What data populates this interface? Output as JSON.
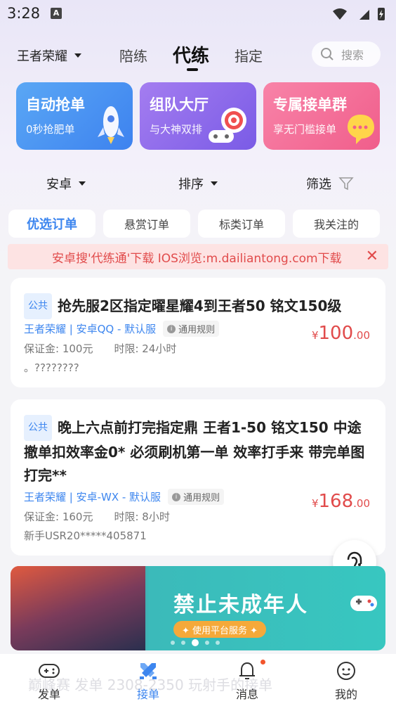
{
  "status_bar": {
    "time": "3:28",
    "notif_letter": "A"
  },
  "top_nav": {
    "game": "王者荣耀",
    "tabs": [
      "陪练",
      "代练",
      "指定"
    ],
    "active_tab": "代练",
    "search_placeholder": "搜索"
  },
  "features": [
    {
      "title": "自动抢单",
      "subtitle": "0秒抢肥单"
    },
    {
      "title": "组队大厅",
      "subtitle": "与大神双排"
    },
    {
      "title": "专属接单群",
      "subtitle": "享无门槛接单"
    }
  ],
  "filters": {
    "platform": "安卓",
    "sort": "排序",
    "filter": "筛选"
  },
  "order_tabs": [
    "优选订单",
    "悬赏订单",
    "标类订单",
    "我关注的"
  ],
  "notice": "安卓搜'代练通'下载 IOS浏览:m.dailiantong.com下载",
  "orders": [
    {
      "badge": "公共",
      "title": "抢先服2区指定曜星耀4到王者50 铭文150级",
      "meta": "王者荣耀 | 安卓QQ - 默认服",
      "rule": "通用规则",
      "deposit": "保证金: 100元",
      "time_limit": "时限: 24小时",
      "note": "。????????",
      "price_symbol": "¥",
      "price_int": "100",
      "price_dec": ".00"
    },
    {
      "badge": "公共",
      "title": "晚上六点前打完指定鼎 王者1-50 铭文150 中途撤单扣效率金0* 必须刷机第一单 效率打手来 带完单图 打完**",
      "meta": "王者荣耀 | 安卓-WX - 默认服",
      "rule": "通用规则",
      "deposit": "保证金: 160元",
      "time_limit": "时限: 8小时",
      "note": "新手USR20*****405871",
      "price_symbol": "¥",
      "price_int": "168",
      "price_dec": ".00"
    }
  ],
  "banner": {
    "title": "禁止未成年人",
    "button": "✦ 使用平台服务 ✦"
  },
  "bottom_nav": [
    "发单",
    "接单",
    "消息",
    "我的"
  ],
  "ghost_text": "巅峰赛 发单 2308-2350 玩射手的接单"
}
